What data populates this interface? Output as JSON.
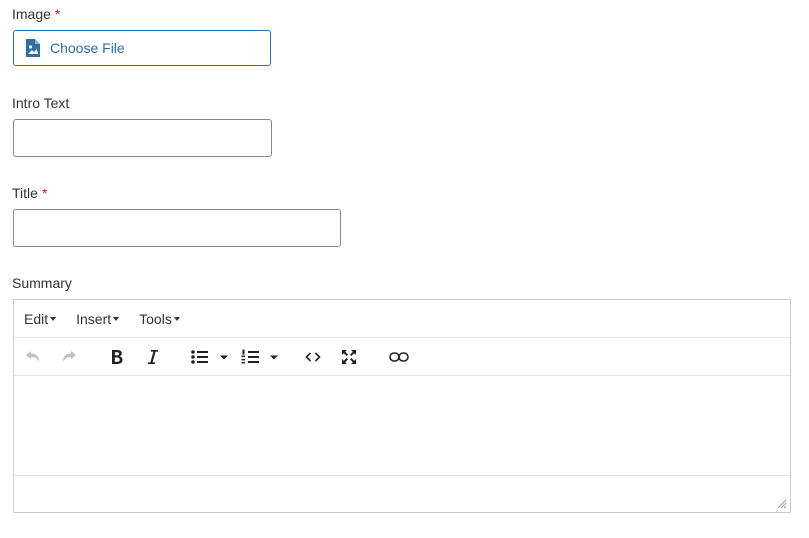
{
  "fields": {
    "image": {
      "label": "Image",
      "required_mark": "*",
      "button_label": "Choose File"
    },
    "intro_text": {
      "label": "Intro Text",
      "value": ""
    },
    "title": {
      "label": "Title",
      "required_mark": "*",
      "value": ""
    },
    "summary": {
      "label": "Summary"
    }
  },
  "editor": {
    "menu": [
      "Edit",
      "Insert",
      "Tools"
    ],
    "toolbar_icons": [
      "undo-icon",
      "redo-icon",
      "bold-icon",
      "italic-icon",
      "bullet-list-icon",
      "numbered-list-icon",
      "code-icon",
      "fullscreen-icon",
      "unlink-icon"
    ],
    "content": ""
  },
  "colors": {
    "accent": "#2f6f9f",
    "required": "#c8102e",
    "text": "#333333"
  }
}
